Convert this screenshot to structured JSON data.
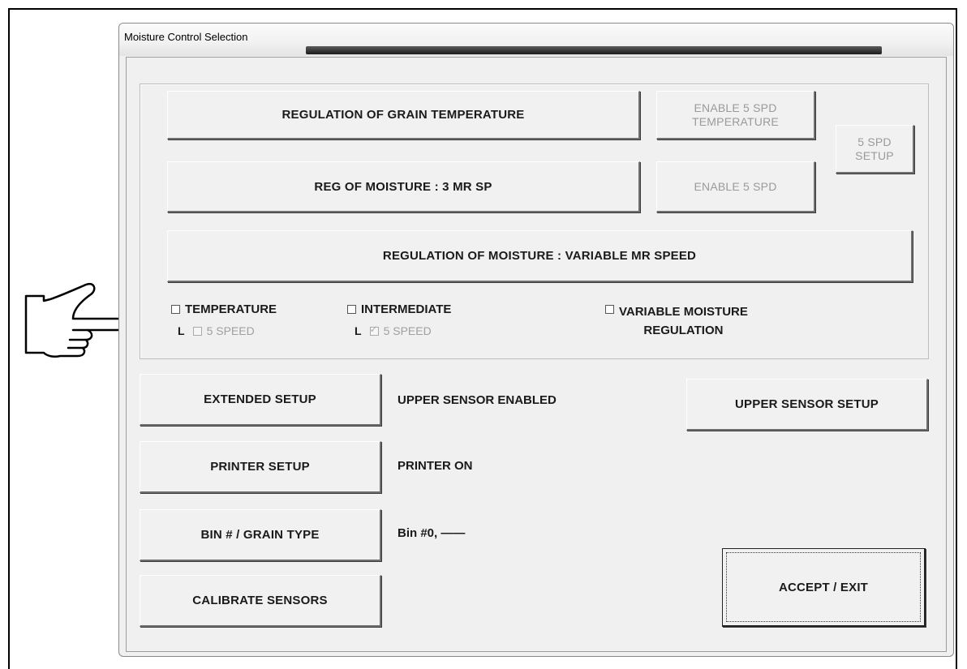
{
  "window": {
    "title": "Moisture Control Selection"
  },
  "group": {
    "btn_grain_temp": "REGULATION OF GRAIN TEMPERATURE",
    "btn_enable_5spd_temp_line1": "ENABLE 5 SPD",
    "btn_enable_5spd_temp_line2": "TEMPERATURE",
    "btn_5spd_setup_line1": "5 SPD",
    "btn_5spd_setup_line2": "SETUP",
    "btn_moisture_3mr": "REG OF MOISTURE : 3 MR SP",
    "btn_enable_5spd": "ENABLE 5 SPD",
    "btn_moisture_variable": "REGULATION OF MOISTURE : VARIABLE MR SPEED",
    "checkboxes": {
      "temperature": {
        "label": "TEMPERATURE",
        "checked": false
      },
      "intermediate": {
        "label": "INTERMEDIATE",
        "checked": false
      },
      "variable_line1": "VARIABLE MOISTURE",
      "variable_line2": "REGULATION",
      "temp_5speed": {
        "label": "5 SPEED",
        "checked": false
      },
      "inter_5speed": {
        "label": "5 SPEED",
        "checked": true
      },
      "l_mark": "L"
    }
  },
  "lower": {
    "btn_extended_setup": "EXTENDED SETUP",
    "upper_sensor_status": "UPPER SENSOR ENABLED",
    "btn_upper_sensor_setup": "UPPER SENSOR SETUP",
    "btn_printer_setup": "PRINTER SETUP",
    "printer_status": "PRINTER ON",
    "btn_bin_grain": "BIN # / GRAIN TYPE",
    "bin_status": "Bin #0, ——",
    "btn_calibrate": "CALIBRATE SENSORS",
    "btn_accept_exit": "ACCEPT / EXIT"
  },
  "icons": {
    "pointer": "pointing-hand-icon"
  }
}
